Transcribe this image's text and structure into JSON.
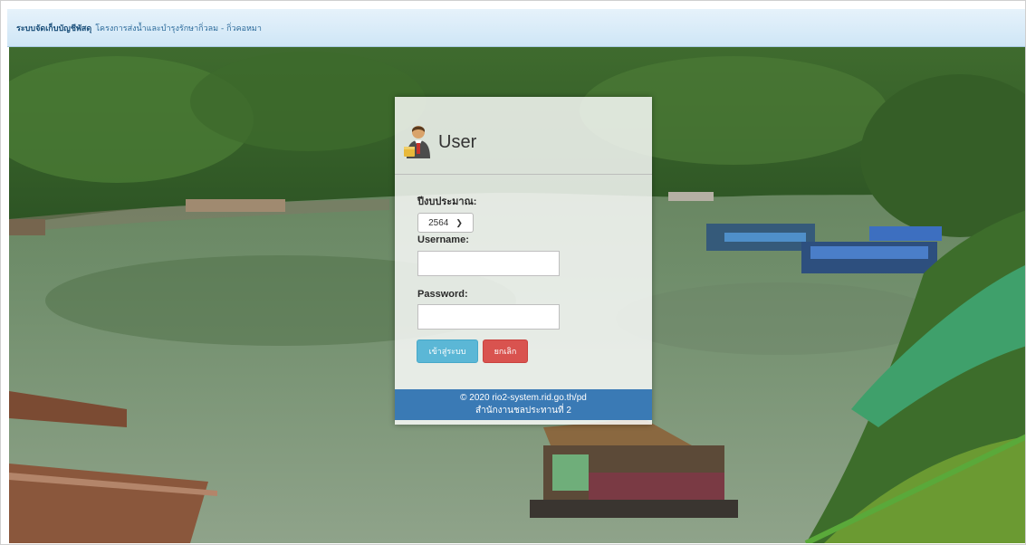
{
  "topbar": {
    "brand": "ระบบจัดเก็บบัญชีพัสดุ",
    "subtitle": "โครงการส่งน้ำและบำรุงรักษากิ่วลม - กิ่วคอหมา"
  },
  "login": {
    "title": "User",
    "fiscal_year_label": "ปีงบประมาณ:",
    "fiscal_year_value": "2564",
    "username_label": "Username:",
    "username_value": "",
    "password_label": "Password:",
    "password_value": "",
    "login_button": "เข้าสู่ระบบ",
    "cancel_button": "ยกเลิก",
    "footer_line1": "© 2020 rio2-system.rid.go.th/pd",
    "footer_line2": "สำนักงานชลประทานที่ 2"
  },
  "icons": {
    "avatar": "user-avatar-icon",
    "select_arrow": "chevron-down-icon"
  },
  "colors": {
    "topbar": "#d7ebf8",
    "login_button": "#5bb7d6",
    "cancel_button": "#d9534f",
    "footer": "#3a7ab5"
  }
}
